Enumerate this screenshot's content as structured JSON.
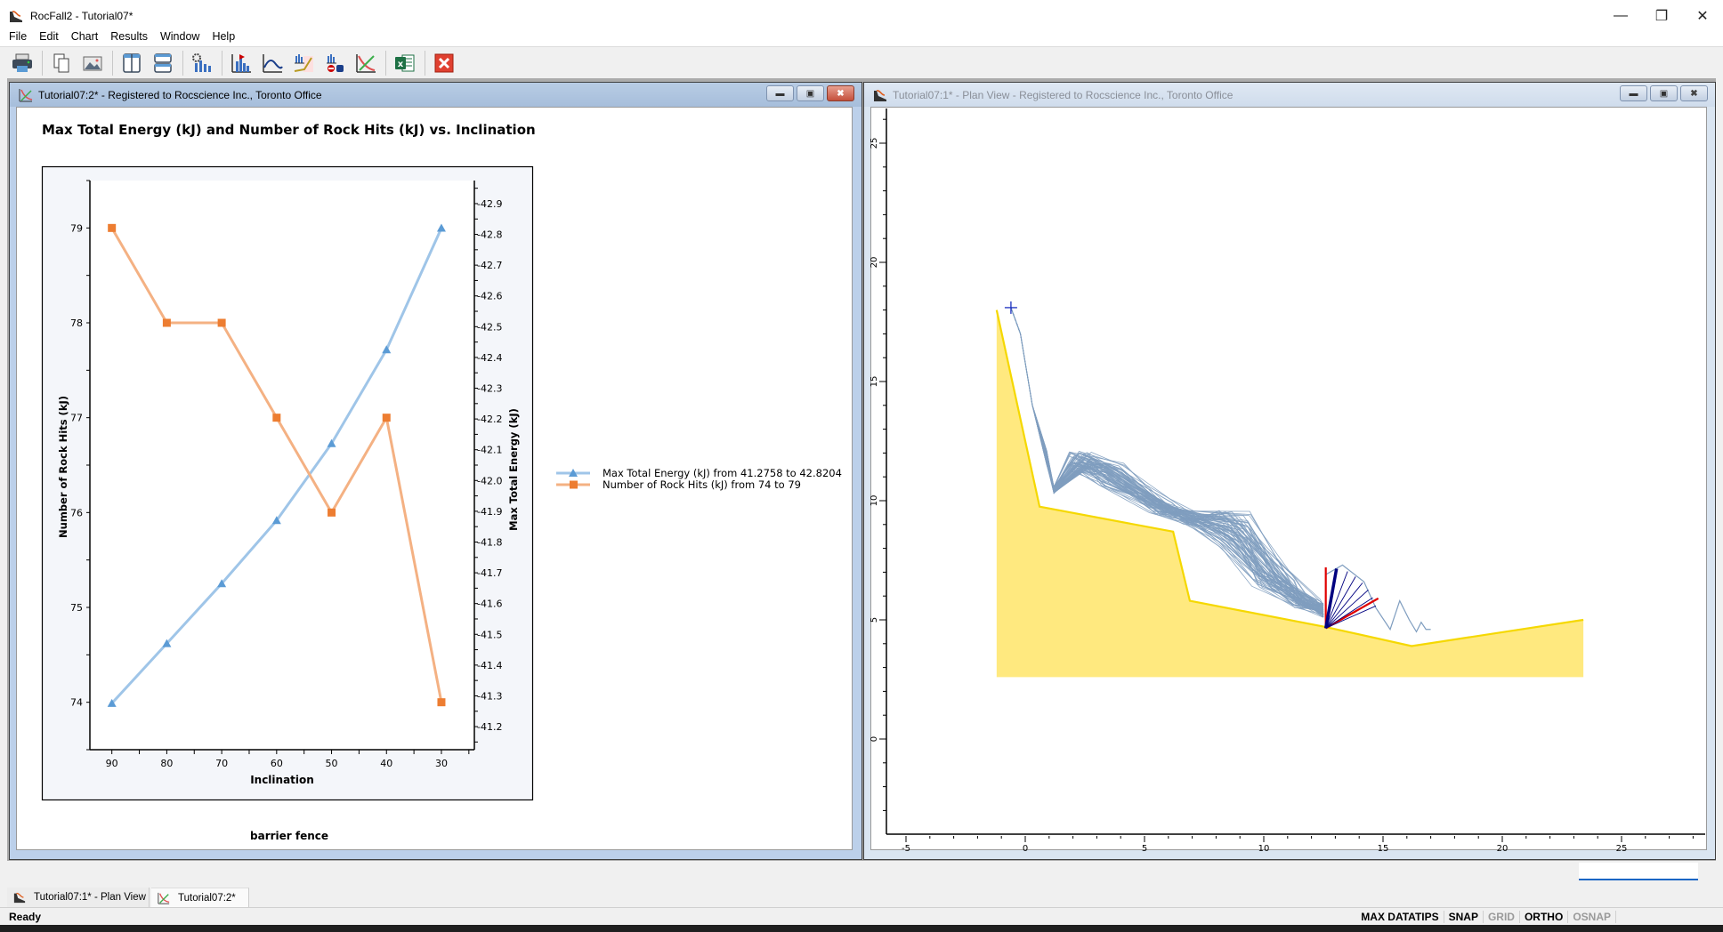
{
  "app": {
    "title": "RocFall2 - Tutorial07*",
    "window_controls": [
      "minimize",
      "restore",
      "close"
    ]
  },
  "menu": {
    "items": [
      "File",
      "Edit",
      "Chart",
      "Results",
      "Window",
      "Help"
    ]
  },
  "toolbar": {
    "buttons": [
      {
        "icon": "printer-icon"
      },
      {
        "icon": "copy-icon"
      },
      {
        "icon": "export-image-icon"
      },
      {
        "icon": "tile-vertical-icon"
      },
      {
        "icon": "tile-horizontal-icon"
      },
      {
        "icon": "chart-settings-icon"
      },
      {
        "icon": "bar-chart-flag-icon"
      },
      {
        "icon": "line-chart-icon"
      },
      {
        "icon": "histogram-cumulative-icon"
      },
      {
        "icon": "histogram-filter-icon"
      },
      {
        "icon": "xy-chart-icon"
      },
      {
        "icon": "excel-export-icon"
      },
      {
        "icon": "close-red-icon"
      }
    ]
  },
  "chart_window": {
    "title": "Tutorial07:2* - Registered to Rocscience Inc., Toronto Office",
    "footer": "barrier fence"
  },
  "plan_window": {
    "title": "Tutorial07:1* - Plan View - Registered to Rocscience Inc., Toronto Office",
    "x_ticks": [
      "-5",
      "0",
      "5",
      "10",
      "15",
      "20",
      "25"
    ],
    "y_ticks": [
      "0",
      "5",
      "10",
      "15",
      "20",
      "25"
    ],
    "slope_color": "#f5d800",
    "slope_fill": "#ffe97f",
    "path_color": "#7f9dbf",
    "barrier_color": "#e00000",
    "barrier_inner_color": "#000080"
  },
  "chart_data": {
    "type": "line",
    "title": "Max Total Energy (kJ) and Number of Rock Hits (kJ) vs. Inclination",
    "xlabel": "Inclination",
    "ylabel_left": "Number of Rock Hits (kJ)",
    "ylabel_right": "Max Total Energy (kJ)",
    "x": [
      90,
      80,
      70,
      60,
      50,
      40,
      30
    ],
    "x_ticks": [
      "90",
      "80",
      "70",
      "60",
      "50",
      "40",
      "30"
    ],
    "xlim": [
      94,
      24
    ],
    "y_left_ticks": [
      "74",
      "75",
      "76",
      "77",
      "78",
      "79"
    ],
    "ylim_left": [
      73.5,
      79.5
    ],
    "y_right_ticks": [
      "41.2",
      "41.3",
      "41.4",
      "41.5",
      "41.6",
      "41.7",
      "41.8",
      "41.9",
      "42.0",
      "42.1",
      "42.2",
      "42.3",
      "42.4",
      "42.5",
      "42.6",
      "42.7",
      "42.8",
      "42.9"
    ],
    "ylim_right": [
      41.125,
      42.975
    ],
    "grid": false,
    "legend_position": "right",
    "series": [
      {
        "name": "Max Total Energy (kJ) from 41.2758 to 42.8204",
        "axis": "right",
        "marker": "triangle",
        "line_color": "#9fc5e8",
        "marker_color": "#5b9bd5",
        "values": [
          41.2758,
          41.47,
          41.665,
          41.87,
          42.12,
          42.425,
          42.8204
        ]
      },
      {
        "name": "Number of Rock Hits (kJ) from 74 to 79",
        "axis": "left",
        "marker": "square",
        "line_color": "#f4b183",
        "marker_color": "#ed7d31",
        "values": [
          79,
          78,
          78,
          77,
          76,
          77,
          74
        ]
      }
    ]
  },
  "tabs": [
    {
      "label": "Tutorial07:1* - Plan View",
      "active": false
    },
    {
      "label": "Tutorial07:2*",
      "active": true
    }
  ],
  "status": {
    "text": "Ready",
    "flags": [
      {
        "label": "MAX DATATIPS",
        "on": true
      },
      {
        "label": "SNAP",
        "on": true
      },
      {
        "label": "GRID",
        "on": false
      },
      {
        "label": "ORTHO",
        "on": true
      },
      {
        "label": "OSNAP",
        "on": false
      }
    ]
  }
}
